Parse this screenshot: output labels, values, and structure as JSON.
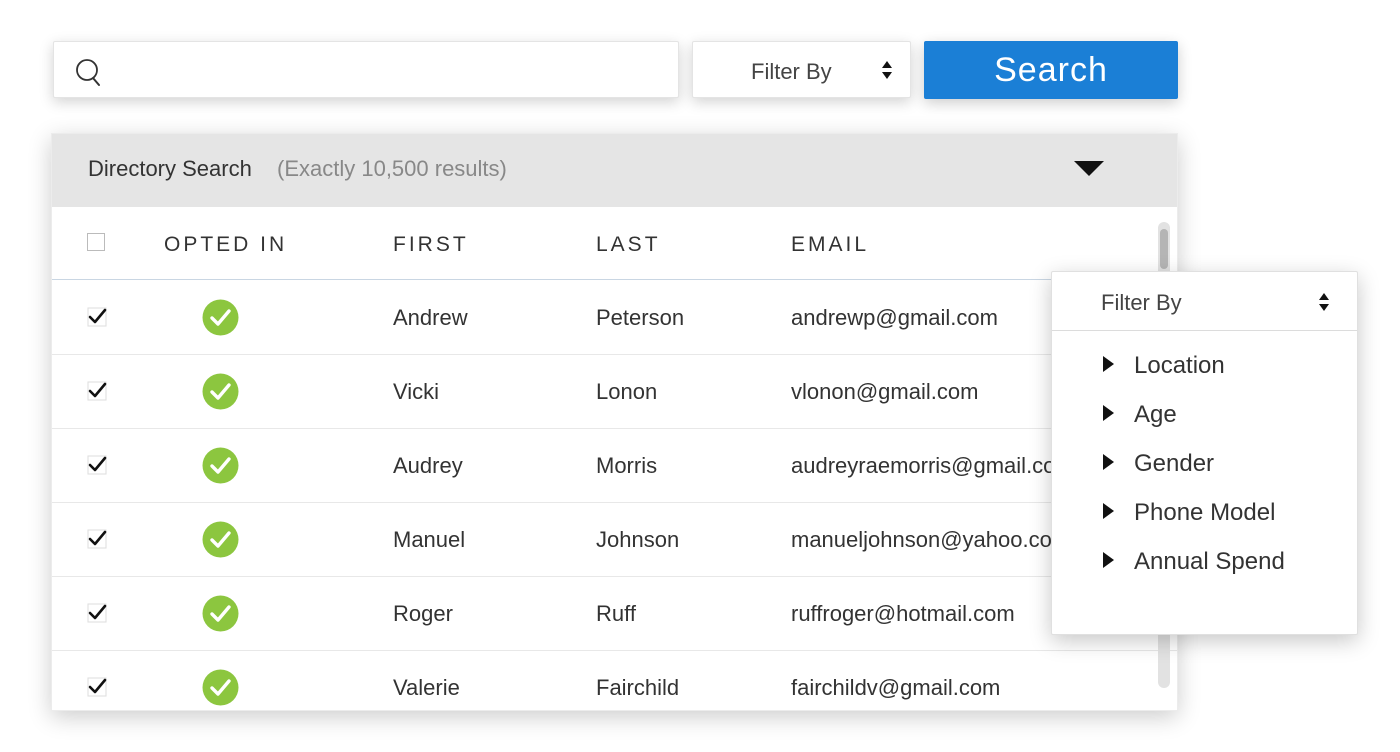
{
  "search": {
    "placeholder": "",
    "value": "",
    "icon": "search-icon"
  },
  "filter": {
    "label": "Filter By",
    "icon": "sort-updown-icon"
  },
  "search_button": {
    "label": "Search",
    "color": "#1b7fd6"
  },
  "directory": {
    "title": "Directory Search",
    "count": "(Exactly  10,500 results)",
    "columns": [
      "OPTED IN",
      "FIRST",
      "LAST",
      "EMAIL"
    ],
    "rows": [
      {
        "checked": true,
        "opted_in": true,
        "first": "Andrew",
        "last": "Peterson",
        "email": "andrewp@gmail.com"
      },
      {
        "checked": true,
        "opted_in": true,
        "first": "Vicki",
        "last": "Lonon",
        "email": "vlonon@gmail.com"
      },
      {
        "checked": true,
        "opted_in": true,
        "first": "Audrey",
        "last": "Morris",
        "email": "audreyraemorris@gmail.com"
      },
      {
        "checked": true,
        "opted_in": true,
        "first": "Manuel",
        "last": "Johnson",
        "email": "manueljohnson@yahoo.com"
      },
      {
        "checked": true,
        "opted_in": true,
        "first": "Roger",
        "last": "Ruff",
        "email": "ruffroger@hotmail.com"
      },
      {
        "checked": true,
        "opted_in": true,
        "first": "Valerie",
        "last": "Fairchild",
        "email": "fairchildv@gmail.com"
      }
    ],
    "opted_color": "#8cc63f"
  },
  "dropdown": {
    "label": "Filter By",
    "items": [
      "Location",
      "Age",
      "Gender",
      "Phone Model",
      "Annual Spend"
    ]
  }
}
